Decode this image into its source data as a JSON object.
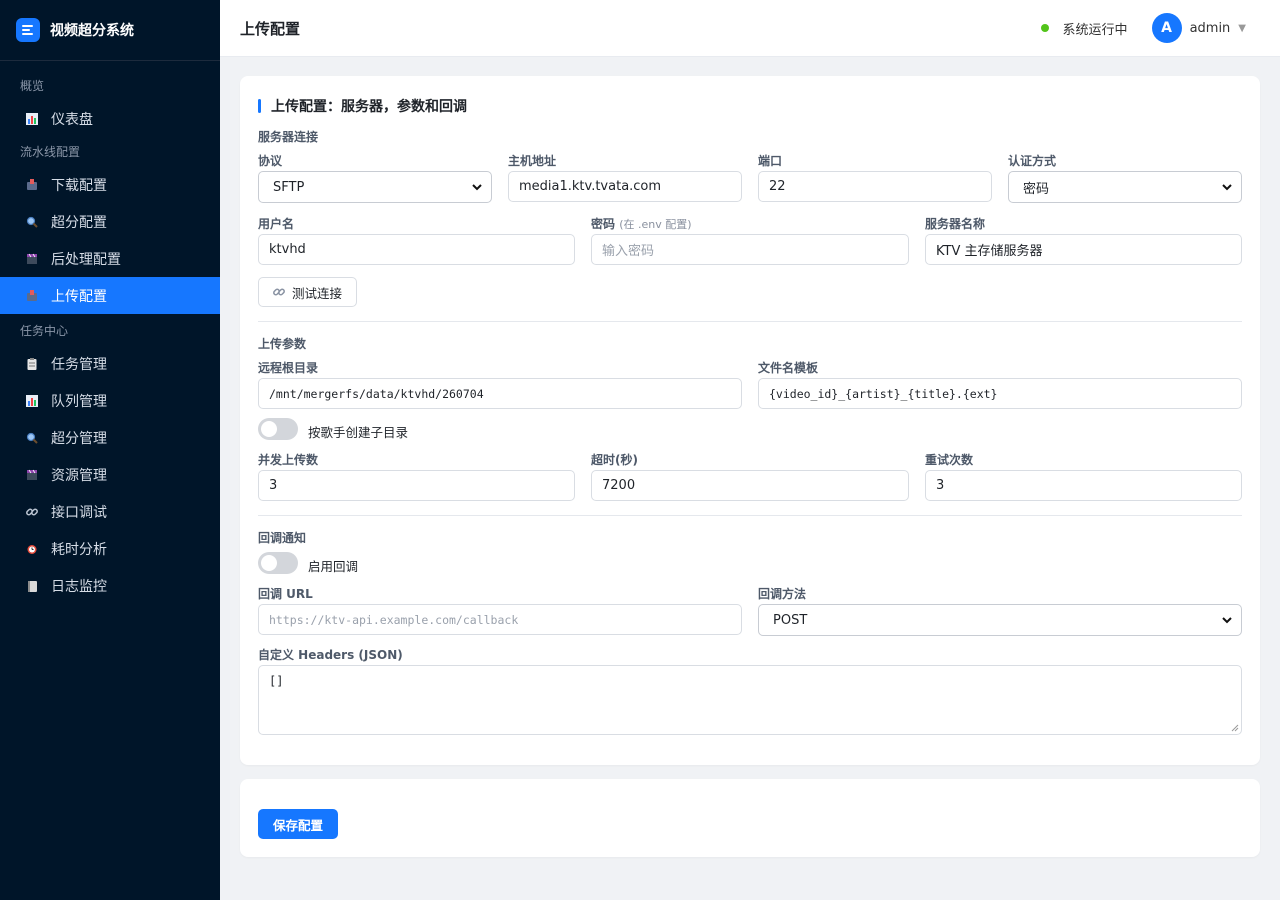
{
  "app": {
    "title": "视频超分系统"
  },
  "sidebar": {
    "groups": [
      {
        "label": "概览",
        "items": [
          {
            "label": "仪表盘",
            "icon": "bar-chart-icon"
          }
        ]
      },
      {
        "label": "流水线配置",
        "items": [
          {
            "label": "下载配置",
            "icon": "download-icon"
          },
          {
            "label": "超分配置",
            "icon": "magnifier-icon"
          },
          {
            "label": "后处理配置",
            "icon": "clapper-icon"
          },
          {
            "label": "上传配置",
            "icon": "upload-icon",
            "active": true
          }
        ]
      },
      {
        "label": "任务中心",
        "items": [
          {
            "label": "任务管理",
            "icon": "clipboard-icon"
          },
          {
            "label": "队列管理",
            "icon": "bar-chart-icon"
          },
          {
            "label": "超分管理",
            "icon": "magnifier-icon"
          },
          {
            "label": "资源管理",
            "icon": "clapper-icon"
          },
          {
            "label": "接口调试",
            "icon": "link-icon"
          },
          {
            "label": "耗时分析",
            "icon": "alarm-clock-icon"
          },
          {
            "label": "日志监控",
            "icon": "notebook-icon"
          }
        ]
      }
    ]
  },
  "header": {
    "title": "上传配置",
    "status_text": "系统运行中",
    "status_color": "#52c41a",
    "avatar_letter": "A",
    "user_name": "admin"
  },
  "form": {
    "title": "上传配置：服务器，参数和回调",
    "server": {
      "section_label": "服务器连接",
      "protocol_label": "协议",
      "protocol_value": "SFTP",
      "host_label": "主机地址",
      "host_value": "media1.ktv.tvata.com",
      "port_label": "端口",
      "port_value": "22",
      "auth_label": "认证方式",
      "auth_value": "密码",
      "username_label": "用户名",
      "username_value": "ktvhd",
      "password_label": "密码",
      "password_hint": "(在 .env 配置)",
      "password_placeholder": "输入密码",
      "server_name_label": "服务器名称",
      "server_name_value": "KTV 主存储服务器",
      "test_button": "测试连接"
    },
    "upload": {
      "section_label": "上传参数",
      "remote_root_label": "远程根目录",
      "remote_root_value": "/mnt/mergerfs/data/ktvhd/260704",
      "filename_template_label": "文件名模板",
      "filename_template_value": "{video_id}_{artist}_{title}.{ext}",
      "artist_subdir_label": "按歌手创建子目录",
      "artist_subdir_on": false,
      "concurrency_label": "并发上传数",
      "concurrency_value": "3",
      "timeout_label": "超时(秒)",
      "timeout_value": "7200",
      "retry_label": "重试次数",
      "retry_value": "3"
    },
    "callback": {
      "section_label": "回调通知",
      "enable_label": "启用回调",
      "enable_on": false,
      "url_label": "回调 URL",
      "url_placeholder": "https://ktv-api.example.com/callback",
      "method_label": "回调方法",
      "method_value": "POST",
      "headers_label": "自定义 Headers (JSON)",
      "headers_value": "[]"
    },
    "save_button": "保存配置"
  }
}
